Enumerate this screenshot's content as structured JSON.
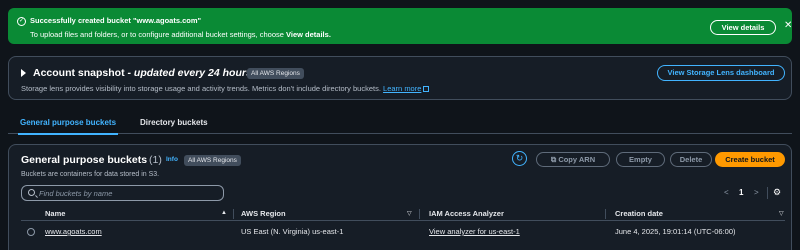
{
  "flash": {
    "title": "Successfully created bucket \"www.agoats.com\"",
    "message": "To upload files and folders, or to configure additional bucket settings, choose",
    "message_bold": "View details.",
    "view_details_label": "View details",
    "icon": "check-circle-icon",
    "close_icon": "close-icon",
    "color": "#0a8a35"
  },
  "snapshot": {
    "title": "Account snapshot",
    "title_suffix": "- updated every 24 hours",
    "badge": "All AWS Regions",
    "description": "Storage lens provides visibility into storage usage and activity trends. Metrics don't include directory buckets.",
    "learn_more": "Learn more",
    "lens_button": "View Storage Lens dashboard"
  },
  "tabs": [
    {
      "label": "General purpose buckets",
      "active": true
    },
    {
      "label": "Directory buckets",
      "active": false
    }
  ],
  "buckets": {
    "title": "General purpose buckets",
    "count": "(1)",
    "info": "Info",
    "badge": "All AWS Regions",
    "description": "Buckets are containers for data stored in S3.",
    "buttons": {
      "copy_arn": "Copy ARN",
      "empty": "Empty",
      "delete": "Delete",
      "create": "Create bucket"
    },
    "search_placeholder": "Find buckets by name",
    "pagination": {
      "prev": "<",
      "page": "1",
      "next": ">"
    },
    "columns": [
      "Name",
      "AWS Region",
      "IAM Access Analyzer",
      "Creation date"
    ],
    "rows": [
      {
        "name": "www.agoats.com",
        "region": "US East (N. Virginia) us-east-1",
        "analyzer": "View analyzer for us-east-1",
        "created": "June 4, 2025, 19:01:14 (UTC-06:00)"
      }
    ]
  },
  "colors": {
    "accent": "#42b4ff",
    "primary_button": "#ff9900",
    "background": "#0f141a"
  }
}
